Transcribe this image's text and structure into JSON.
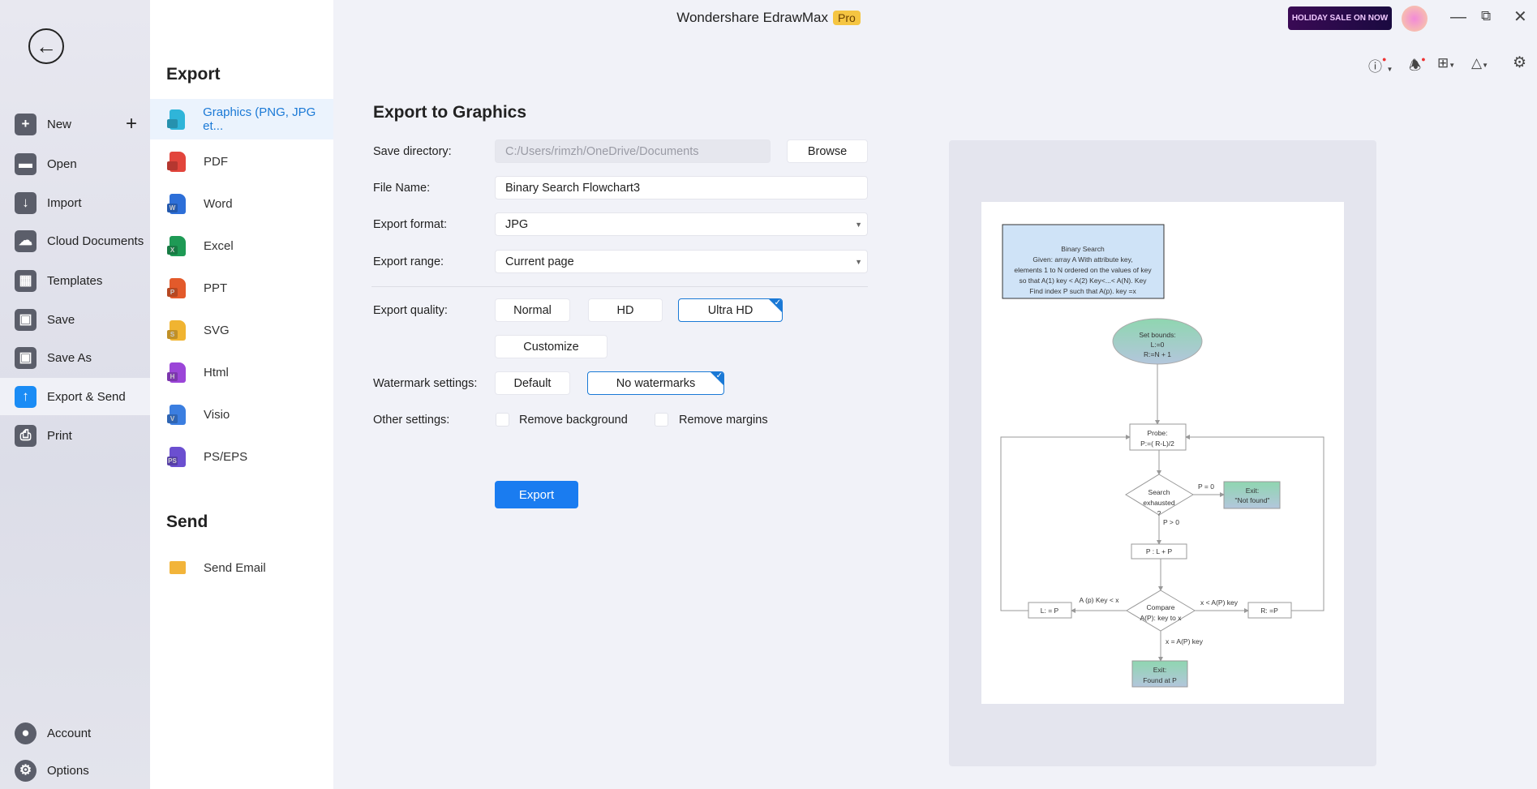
{
  "window": {
    "title": "Wondershare EdrawMax",
    "badge": "Pro",
    "promo": "HOLIDAY SALE ON NOW"
  },
  "sidebar": {
    "items": [
      {
        "label": "New",
        "icon": "plus-square-icon"
      },
      {
        "label": "Open",
        "icon": "folder-icon"
      },
      {
        "label": "Import",
        "icon": "import-icon"
      },
      {
        "label": "Cloud Documents",
        "icon": "cloud-icon"
      },
      {
        "label": "Templates",
        "icon": "templates-icon"
      },
      {
        "label": "Save",
        "icon": "save-icon"
      },
      {
        "label": "Save As",
        "icon": "save-as-icon"
      },
      {
        "label": "Export & Send",
        "icon": "export-icon",
        "selected": true
      },
      {
        "label": "Print",
        "icon": "print-icon"
      }
    ],
    "bottom": [
      {
        "label": "Account",
        "icon": "account-icon"
      },
      {
        "label": "Options",
        "icon": "gear-icon"
      }
    ]
  },
  "export_menu": {
    "heading": "Export",
    "items": [
      {
        "label": "Graphics (PNG, JPG et...",
        "badge": "",
        "color": "#2fb5d9"
      },
      {
        "label": "PDF",
        "badge": "",
        "color": "#e2453c"
      },
      {
        "label": "Word",
        "badge": "W",
        "color": "#2d6fd8"
      },
      {
        "label": "Excel",
        "badge": "X",
        "color": "#1e9a55"
      },
      {
        "label": "PPT",
        "badge": "P",
        "color": "#e35a2b"
      },
      {
        "label": "SVG",
        "badge": "S",
        "color": "#f0b431"
      },
      {
        "label": "Html",
        "badge": "H",
        "color": "#9b45d8"
      },
      {
        "label": "Visio",
        "badge": "V",
        "color": "#3b7ee0"
      },
      {
        "label": "PS/EPS",
        "badge": "PS",
        "color": "#6b4fd0"
      }
    ],
    "send_heading": "Send",
    "send_items": [
      {
        "label": "Send Email",
        "color": "#f2b43a"
      }
    ]
  },
  "form": {
    "title": "Export to Graphics",
    "save_directory": {
      "label": "Save directory:",
      "value": "C:/Users/rimzh/OneDrive/Documents",
      "browse": "Browse"
    },
    "file_name": {
      "label": "File Name:",
      "value": "Binary Search Flowchart3"
    },
    "format": {
      "label": "Export format:",
      "value": "JPG"
    },
    "range": {
      "label": "Export range:",
      "value": "Current page"
    },
    "quality": {
      "label": "Export quality:",
      "options": [
        "Normal",
        "HD",
        "Ultra HD",
        "Customize"
      ],
      "selected": "Ultra HD"
    },
    "watermark": {
      "label": "Watermark settings:",
      "options": [
        "Default",
        "No watermarks"
      ],
      "selected": "No watermarks"
    },
    "other": {
      "label": "Other settings:",
      "remove_background": "Remove background",
      "remove_margins": "Remove margins",
      "remove_background_checked": false,
      "remove_margins_checked": false
    },
    "export_button": "Export"
  },
  "flowchart": {
    "info": [
      "Binary Search",
      "Given: array A With attribute key,",
      "elements 1 to N ordered on the values of key",
      "so that A(1) key < A(2) Key<...< A(N). Key",
      "Find index P such that A(p). key =x"
    ],
    "start": [
      "Set bounds:",
      "L:=0",
      "R:=N + 1"
    ],
    "probe": [
      "Probe:",
      "P:=( R-L)/2"
    ],
    "decision1": [
      "Search",
      "exhausted",
      "?"
    ],
    "exit_notfound": [
      "Exit:",
      "\"Not found\""
    ],
    "p_eq_0": "P = 0",
    "p_gt_0": "P > 0",
    "update": "P : L + P",
    "decision2": [
      "Compare",
      "A(P): key to x"
    ],
    "left_label": "A (p) Key < x",
    "right_label": "x < A(P) key",
    "down_label": "x = A(P) key",
    "left_box": "L: = P",
    "right_box": "R: =P",
    "exit_found": [
      "Exit:",
      "Found at P"
    ]
  }
}
